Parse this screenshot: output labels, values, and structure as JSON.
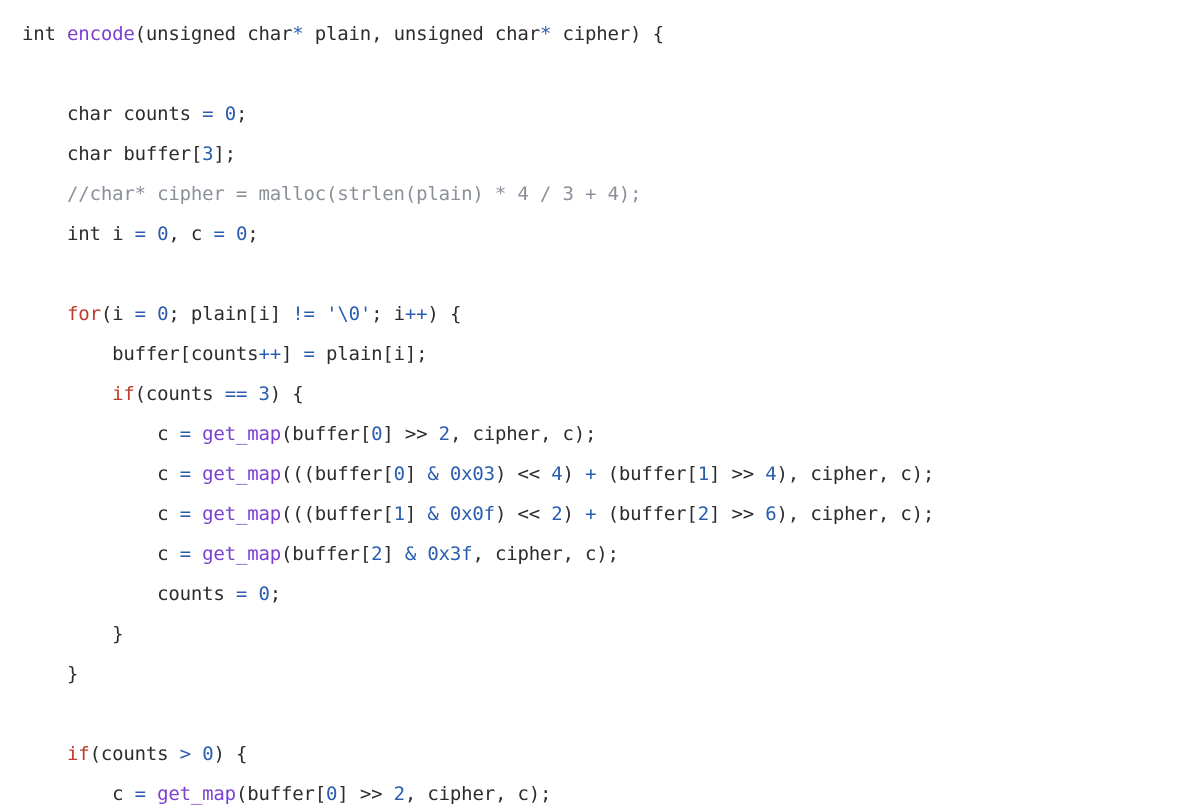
{
  "editor": {
    "language": "c",
    "background_color": "#ffffff",
    "font_size_px": 19,
    "line_height_px": 40,
    "indent_size": 4
  },
  "theme": {
    "default_color": "#2b2b30",
    "keyword_color": "#c0392b",
    "function_color": "#7b3fd4",
    "number_color": "#2a5db0",
    "operator_color": "#2a5db0",
    "string_color": "#2a5db0",
    "comment_color": "#8a8f98"
  },
  "code": {
    "lines": [
      {
        "index": 1,
        "text": "int encode(unsigned char* plain, unsigned char* cipher) {",
        "tokens": [
          {
            "t": "int ",
            "k": "default"
          },
          {
            "t": "encode",
            "k": "function"
          },
          {
            "t": "(unsigned char",
            "k": "default"
          },
          {
            "t": "*",
            "k": "operator"
          },
          {
            "t": " plain, unsigned char",
            "k": "default"
          },
          {
            "t": "*",
            "k": "operator"
          },
          {
            "t": " cipher) {",
            "k": "default"
          }
        ]
      },
      {
        "index": 2,
        "text": "",
        "tokens": []
      },
      {
        "index": 3,
        "text": "    char counts = 0;",
        "tokens": [
          {
            "t": "    char counts ",
            "k": "default"
          },
          {
            "t": "=",
            "k": "operator"
          },
          {
            "t": " ",
            "k": "default"
          },
          {
            "t": "0",
            "k": "number"
          },
          {
            "t": ";",
            "k": "default"
          }
        ]
      },
      {
        "index": 4,
        "text": "    char buffer[3];",
        "tokens": [
          {
            "t": "    char buffer[",
            "k": "default"
          },
          {
            "t": "3",
            "k": "number"
          },
          {
            "t": "];",
            "k": "default"
          }
        ]
      },
      {
        "index": 5,
        "text": "    //char* cipher = malloc(strlen(plain) * 4 / 3 + 4);",
        "tokens": [
          {
            "t": "    ",
            "k": "default"
          },
          {
            "t": "//char* cipher = malloc(strlen(plain) * 4 / 3 + 4);",
            "k": "comment"
          }
        ]
      },
      {
        "index": 6,
        "text": "    int i = 0, c = 0;",
        "tokens": [
          {
            "t": "    int i ",
            "k": "default"
          },
          {
            "t": "=",
            "k": "operator"
          },
          {
            "t": " ",
            "k": "default"
          },
          {
            "t": "0",
            "k": "number"
          },
          {
            "t": ", c ",
            "k": "default"
          },
          {
            "t": "=",
            "k": "operator"
          },
          {
            "t": " ",
            "k": "default"
          },
          {
            "t": "0",
            "k": "number"
          },
          {
            "t": ";",
            "k": "default"
          }
        ]
      },
      {
        "index": 7,
        "text": "",
        "tokens": []
      },
      {
        "index": 8,
        "text": "    for(i = 0; plain[i] != '\\0'; i++) {",
        "tokens": [
          {
            "t": "    ",
            "k": "default"
          },
          {
            "t": "for",
            "k": "keyword"
          },
          {
            "t": "(i ",
            "k": "default"
          },
          {
            "t": "=",
            "k": "operator"
          },
          {
            "t": " ",
            "k": "default"
          },
          {
            "t": "0",
            "k": "number"
          },
          {
            "t": "; plain[i] ",
            "k": "default"
          },
          {
            "t": "!=",
            "k": "operator"
          },
          {
            "t": " ",
            "k": "default"
          },
          {
            "t": "'\\0'",
            "k": "string"
          },
          {
            "t": "; i",
            "k": "default"
          },
          {
            "t": "++",
            "k": "operator"
          },
          {
            "t": ") {",
            "k": "default"
          }
        ]
      },
      {
        "index": 9,
        "text": "        buffer[counts++] = plain[i];",
        "tokens": [
          {
            "t": "        buffer[counts",
            "k": "default"
          },
          {
            "t": "++",
            "k": "operator"
          },
          {
            "t": "] ",
            "k": "default"
          },
          {
            "t": "=",
            "k": "operator"
          },
          {
            "t": " plain[i];",
            "k": "default"
          }
        ]
      },
      {
        "index": 10,
        "text": "        if(counts == 3) {",
        "tokens": [
          {
            "t": "        ",
            "k": "default"
          },
          {
            "t": "if",
            "k": "keyword"
          },
          {
            "t": "(counts ",
            "k": "default"
          },
          {
            "t": "==",
            "k": "operator"
          },
          {
            "t": " ",
            "k": "default"
          },
          {
            "t": "3",
            "k": "number"
          },
          {
            "t": ") {",
            "k": "default"
          }
        ]
      },
      {
        "index": 11,
        "text": "            c = get_map(buffer[0] >> 2, cipher, c);",
        "tokens": [
          {
            "t": "            c ",
            "k": "default"
          },
          {
            "t": "=",
            "k": "operator"
          },
          {
            "t": " ",
            "k": "default"
          },
          {
            "t": "get_map",
            "k": "function"
          },
          {
            "t": "(buffer[",
            "k": "default"
          },
          {
            "t": "0",
            "k": "number"
          },
          {
            "t": "] ",
            "k": "default"
          },
          {
            "t": ">>",
            "k": "default"
          },
          {
            "t": " ",
            "k": "default"
          },
          {
            "t": "2",
            "k": "number"
          },
          {
            "t": ", cipher, c);",
            "k": "default"
          }
        ]
      },
      {
        "index": 12,
        "text": "            c = get_map(((buffer[0] & 0x03) << 4) + (buffer[1] >> 4), cipher, c);",
        "tokens": [
          {
            "t": "            c ",
            "k": "default"
          },
          {
            "t": "=",
            "k": "operator"
          },
          {
            "t": " ",
            "k": "default"
          },
          {
            "t": "get_map",
            "k": "function"
          },
          {
            "t": "(((buffer[",
            "k": "default"
          },
          {
            "t": "0",
            "k": "number"
          },
          {
            "t": "] ",
            "k": "default"
          },
          {
            "t": "& 0x03",
            "k": "operator"
          },
          {
            "t": ") ",
            "k": "default"
          },
          {
            "t": "<<",
            "k": "default"
          },
          {
            "t": " ",
            "k": "default"
          },
          {
            "t": "4",
            "k": "number"
          },
          {
            "t": ") ",
            "k": "default"
          },
          {
            "t": "+",
            "k": "operator"
          },
          {
            "t": " (buffer[",
            "k": "default"
          },
          {
            "t": "1",
            "k": "number"
          },
          {
            "t": "] ",
            "k": "default"
          },
          {
            "t": ">>",
            "k": "default"
          },
          {
            "t": " ",
            "k": "default"
          },
          {
            "t": "4",
            "k": "number"
          },
          {
            "t": "), cipher, c);",
            "k": "default"
          }
        ]
      },
      {
        "index": 13,
        "text": "            c = get_map(((buffer[1] & 0x0f) << 2) + (buffer[2] >> 6), cipher, c);",
        "tokens": [
          {
            "t": "            c ",
            "k": "default"
          },
          {
            "t": "=",
            "k": "operator"
          },
          {
            "t": " ",
            "k": "default"
          },
          {
            "t": "get_map",
            "k": "function"
          },
          {
            "t": "(((buffer[",
            "k": "default"
          },
          {
            "t": "1",
            "k": "number"
          },
          {
            "t": "] ",
            "k": "default"
          },
          {
            "t": "& 0x0f",
            "k": "operator"
          },
          {
            "t": ") ",
            "k": "default"
          },
          {
            "t": "<<",
            "k": "default"
          },
          {
            "t": " ",
            "k": "default"
          },
          {
            "t": "2",
            "k": "number"
          },
          {
            "t": ") ",
            "k": "default"
          },
          {
            "t": "+",
            "k": "operator"
          },
          {
            "t": " (buffer[",
            "k": "default"
          },
          {
            "t": "2",
            "k": "number"
          },
          {
            "t": "] ",
            "k": "default"
          },
          {
            "t": ">>",
            "k": "default"
          },
          {
            "t": " ",
            "k": "default"
          },
          {
            "t": "6",
            "k": "number"
          },
          {
            "t": "), cipher, c);",
            "k": "default"
          }
        ]
      },
      {
        "index": 14,
        "text": "            c = get_map(buffer[2] & 0x3f, cipher, c);",
        "tokens": [
          {
            "t": "            c ",
            "k": "default"
          },
          {
            "t": "=",
            "k": "operator"
          },
          {
            "t": " ",
            "k": "default"
          },
          {
            "t": "get_map",
            "k": "function"
          },
          {
            "t": "(buffer[",
            "k": "default"
          },
          {
            "t": "2",
            "k": "number"
          },
          {
            "t": "] ",
            "k": "default"
          },
          {
            "t": "& 0x3f",
            "k": "operator"
          },
          {
            "t": ", cipher, c);",
            "k": "default"
          }
        ]
      },
      {
        "index": 15,
        "text": "            counts = 0;",
        "tokens": [
          {
            "t": "            counts ",
            "k": "default"
          },
          {
            "t": "=",
            "k": "operator"
          },
          {
            "t": " ",
            "k": "default"
          },
          {
            "t": "0",
            "k": "number"
          },
          {
            "t": ";",
            "k": "default"
          }
        ]
      },
      {
        "index": 16,
        "text": "        }",
        "tokens": [
          {
            "t": "        }",
            "k": "default"
          }
        ]
      },
      {
        "index": 17,
        "text": "    }",
        "tokens": [
          {
            "t": "    }",
            "k": "default"
          }
        ]
      },
      {
        "index": 18,
        "text": "",
        "tokens": []
      },
      {
        "index": 19,
        "text": "    if(counts > 0) {",
        "tokens": [
          {
            "t": "    ",
            "k": "default"
          },
          {
            "t": "if",
            "k": "keyword"
          },
          {
            "t": "(counts ",
            "k": "default"
          },
          {
            "t": ">",
            "k": "operator"
          },
          {
            "t": " ",
            "k": "default"
          },
          {
            "t": "0",
            "k": "number"
          },
          {
            "t": ") {",
            "k": "default"
          }
        ]
      },
      {
        "index": 20,
        "text": "        c = get_map(buffer[0] >> 2, cipher, c);",
        "tokens": [
          {
            "t": "        c ",
            "k": "default"
          },
          {
            "t": "=",
            "k": "operator"
          },
          {
            "t": " ",
            "k": "default"
          },
          {
            "t": "get_map",
            "k": "function"
          },
          {
            "t": "(buffer[",
            "k": "default"
          },
          {
            "t": "0",
            "k": "number"
          },
          {
            "t": "] ",
            "k": "default"
          },
          {
            "t": ">>",
            "k": "default"
          },
          {
            "t": " ",
            "k": "default"
          },
          {
            "t": "2",
            "k": "number"
          },
          {
            "t": ", cipher, c);",
            "k": "default"
          }
        ]
      }
    ]
  }
}
